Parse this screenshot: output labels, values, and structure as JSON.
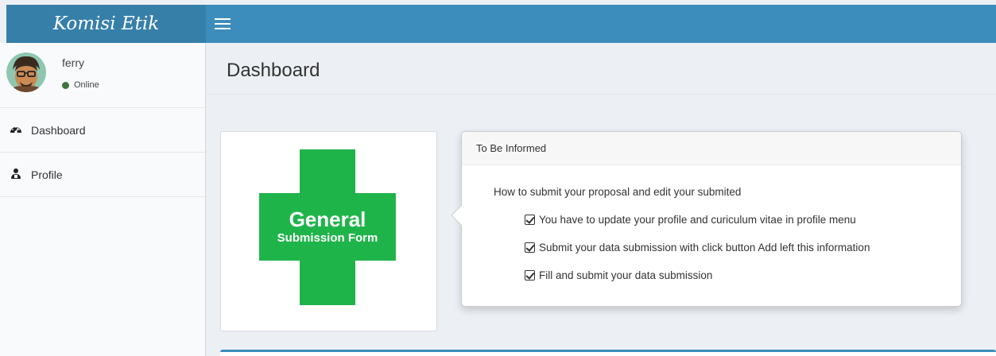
{
  "brand": {
    "title": "Komisi Etik"
  },
  "topbar": {
    "menu_icon": "hamburger-icon",
    "color": "#3c8dbc",
    "logo_bg": "#367fa9"
  },
  "user": {
    "name": "ferry",
    "status": "Online",
    "status_color": "#3c763d"
  },
  "sidebar": {
    "items": [
      {
        "label": "Dashboard",
        "icon": "dashboard-icon"
      },
      {
        "label": "Profile",
        "icon": "user-icon"
      }
    ]
  },
  "page": {
    "title": "Dashboard"
  },
  "form_card": {
    "line1": "General",
    "line2": "Submission Form",
    "color": "#1fb44a"
  },
  "info": {
    "title": "To Be Informed",
    "intro": "How to submit your proposal and edit your submited",
    "items": [
      "You have to update your profile and curiculum vitae in profile menu",
      "Submit your data submission with click button Add left this information",
      "Fill and submit your data submission"
    ]
  }
}
